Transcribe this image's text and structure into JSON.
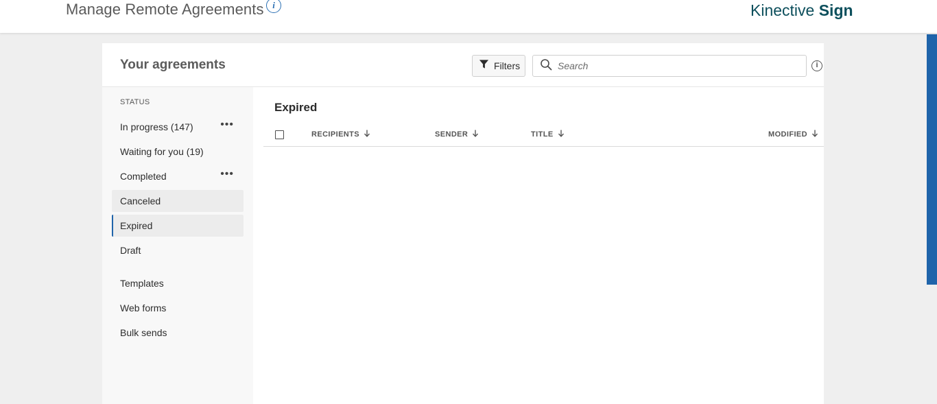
{
  "header": {
    "title": "Manage Remote Agreements",
    "info_glyph": "i",
    "brand_light": "Kinective",
    "brand_bold": "Sign"
  },
  "panel": {
    "title": "Your agreements",
    "filters_label": "Filters",
    "search_placeholder": "Search",
    "info_glyph": "i"
  },
  "sidebar": {
    "status_heading": "STATUS",
    "status_items": [
      {
        "label": "In progress (147)",
        "has_menu": true
      },
      {
        "label": "Waiting for you (19)",
        "has_menu": false
      },
      {
        "label": "Completed",
        "has_menu": true
      },
      {
        "label": "Canceled",
        "has_menu": false
      },
      {
        "label": "Expired",
        "has_menu": false,
        "selected": true
      },
      {
        "label": "Draft",
        "has_menu": false
      }
    ],
    "other_items": [
      {
        "label": "Templates"
      },
      {
        "label": "Web forms"
      },
      {
        "label": "Bulk sends"
      }
    ],
    "menu_glyph": "•••"
  },
  "content": {
    "title": "Expired",
    "columns": [
      "RECIPIENTS",
      "SENDER",
      "TITLE",
      "MODIFIED"
    ]
  },
  "colors": {
    "accent": "#1f64aa",
    "brand": "#0d4f5c",
    "background": "#efefef"
  },
  "icons": {
    "filter": "funnel-icon",
    "search": "magnifier-icon",
    "sort": "arrow-down-icon",
    "info": "info-circle-icon"
  }
}
